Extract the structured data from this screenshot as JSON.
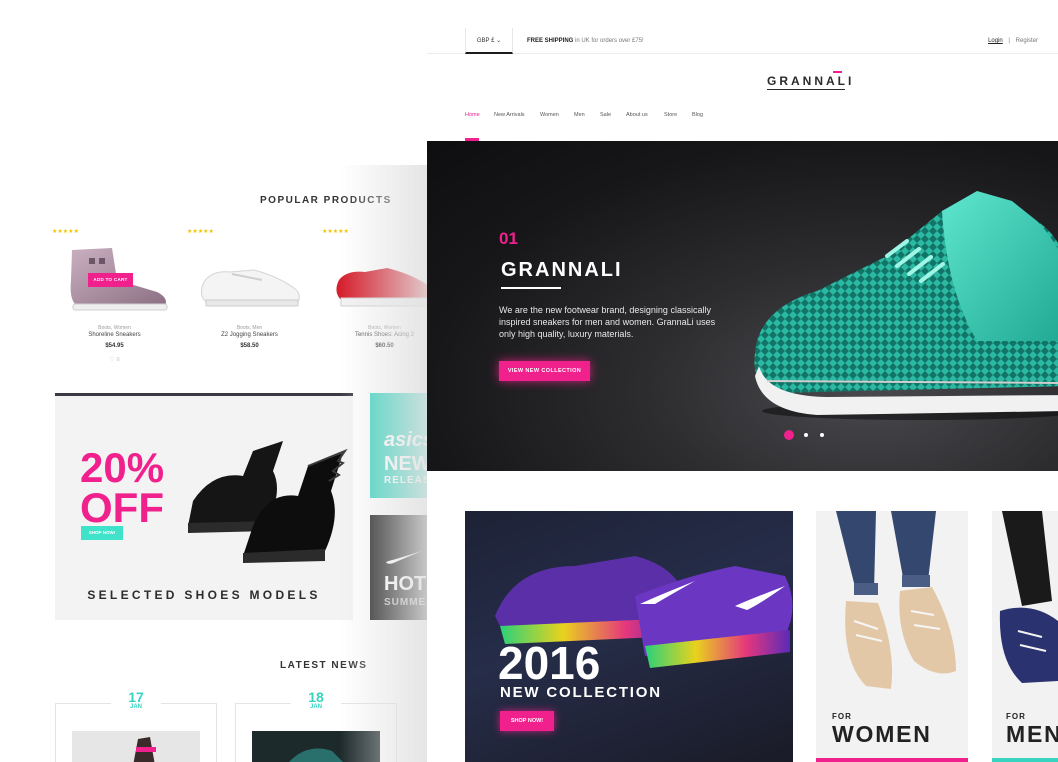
{
  "colors": {
    "accent": "#f0208c",
    "teal": "#38d4c0",
    "dark": "#1c1c1c"
  },
  "back_page": {
    "popular_title": "POPULAR PRODUCTS",
    "products": [
      {
        "rating": "★★★★★",
        "meta": "Boots, Women",
        "name": "Shoreline Sneakers",
        "price": "$54.95",
        "add_to_cart": "ADD TO CART",
        "icons": "♡   ≡"
      },
      {
        "rating": "★★★★★",
        "meta": "Boots, Men",
        "name": "Z2 Jogging Sneakers",
        "price": "$58.50"
      },
      {
        "rating": "★★★★★",
        "meta": "Boots, Women",
        "name": "Tennis Shoes: Acing 2",
        "price": "$60.50"
      }
    ],
    "promo": {
      "line1": "20%",
      "line2": "OFF",
      "button": "SHOP NOW!",
      "subtitle": "SELECTED SHOES MODELS"
    },
    "side_tiles": [
      {
        "brand": "asics",
        "line1": "NEW",
        "line2": "RELEAS"
      },
      {
        "line1": "HOT",
        "line2": "SUMME"
      }
    ],
    "latest_title": "LATEST NEWS",
    "news": [
      {
        "day": "17",
        "month": "JAN"
      },
      {
        "day": "18",
        "month": "JAN"
      }
    ]
  },
  "front": {
    "currency": "GBP £  ⌄",
    "shipping_bold": "FREE SHIPPING",
    "shipping_rest": " in UK for orders over £75!",
    "login": "Login",
    "separator": "|",
    "register": "Register",
    "logo": "GRANNALI",
    "nav": [
      "Home",
      "New Arrivals",
      "Women",
      "Men",
      "Sale",
      "About us",
      "Store",
      "Blog"
    ],
    "hero": {
      "number": "01",
      "title": "GRANNALI",
      "text": "We are the new footwear brand, designing classically inspired sneakers for men and women. GrannaLi uses only high quality, luxury materials.",
      "button": "VIEW NEW COLLECTION",
      "active_slide": 1,
      "slide_count": 3
    },
    "collection": {
      "year": "2016",
      "subtitle": "NEW COLLECTION",
      "button": "SHOP NOW!"
    },
    "categories": [
      {
        "for": "FOR",
        "name": "WOMEN",
        "bar_color": "#f0208c"
      },
      {
        "for": "FOR",
        "name": "MEN",
        "bar_color": "#38d4c0"
      }
    ]
  }
}
